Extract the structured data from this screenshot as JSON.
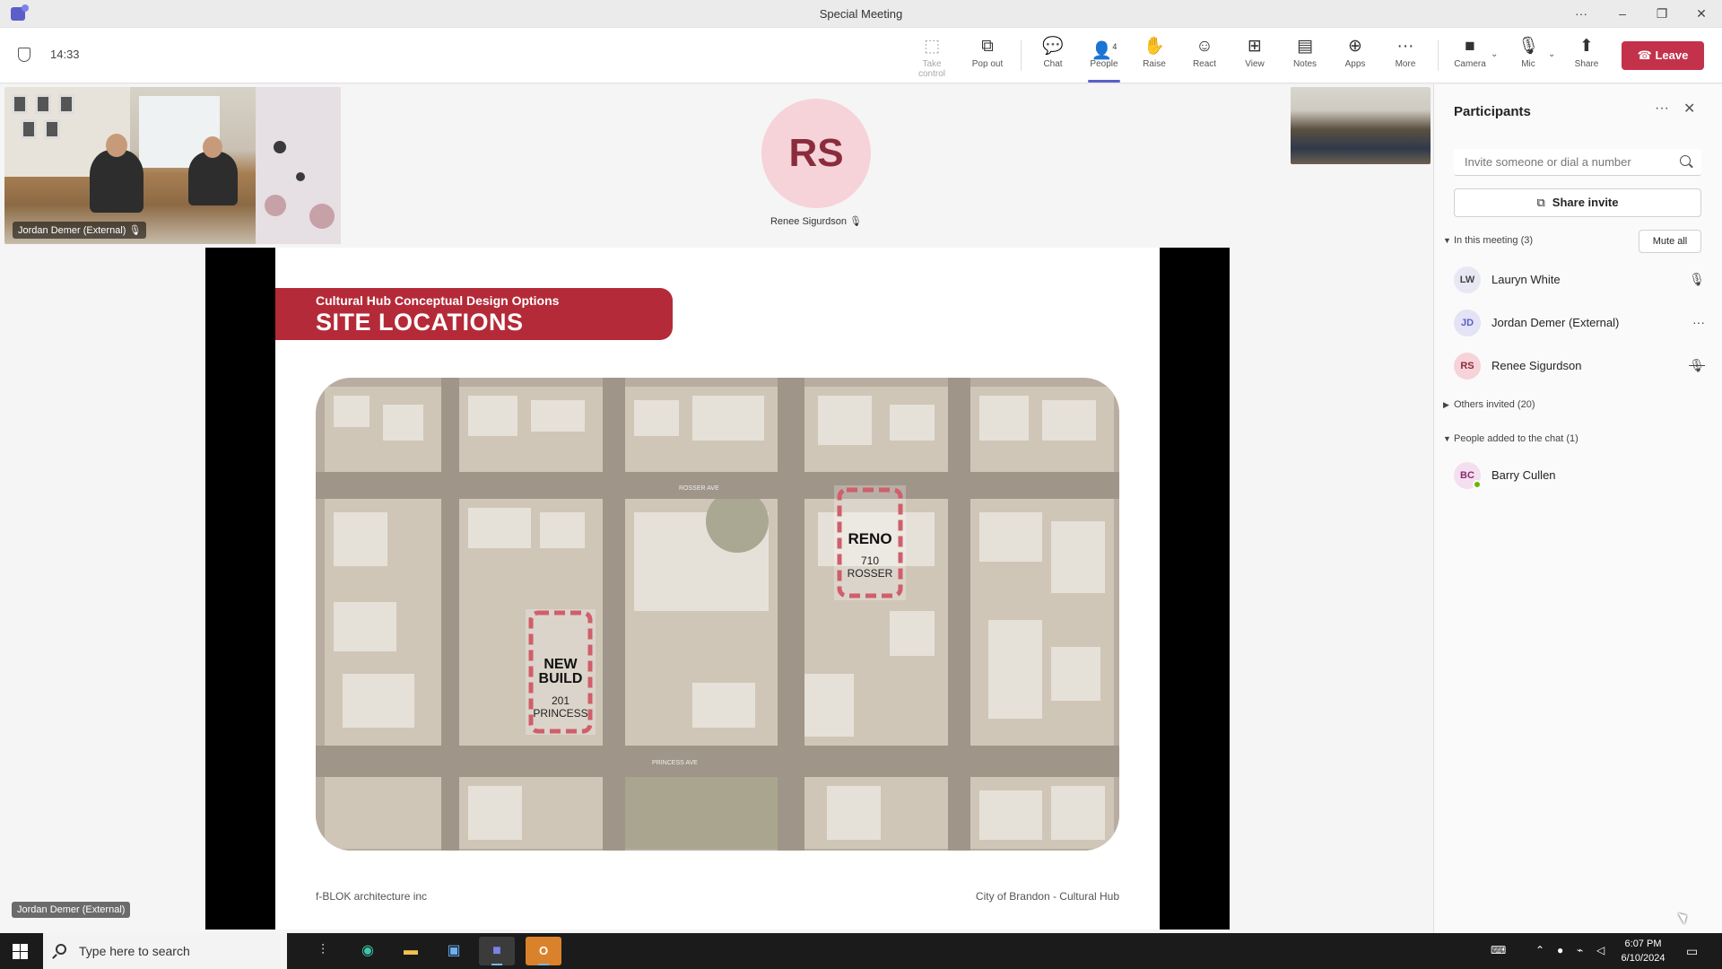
{
  "window": {
    "title": "Special Meeting",
    "controls": {
      "more": "···",
      "minimize": "–",
      "restore": "❐",
      "close": "✕"
    }
  },
  "toolbar": {
    "timer": "14:33",
    "buttons": [
      {
        "label": "Take control",
        "icon": "take-control-icon",
        "glyph": "⬚",
        "disabled": true
      },
      {
        "label": "Pop out",
        "icon": "pop-out-icon",
        "glyph": "⧉"
      },
      {
        "label": "Chat",
        "icon": "chat-icon",
        "glyph": "💬"
      },
      {
        "label": "People",
        "icon": "people-icon",
        "glyph": "👤",
        "badge": "4",
        "active": true
      },
      {
        "label": "Raise",
        "icon": "raise-hand-icon",
        "glyph": "✋"
      },
      {
        "label": "React",
        "icon": "react-icon",
        "glyph": "☺"
      },
      {
        "label": "View",
        "icon": "view-icon",
        "glyph": "⊞"
      },
      {
        "label": "Notes",
        "icon": "notes-icon",
        "glyph": "▤"
      },
      {
        "label": "Apps",
        "icon": "apps-icon",
        "glyph": "⊕"
      },
      {
        "label": "More",
        "icon": "more-icon",
        "glyph": "···"
      },
      {
        "label": "Camera",
        "icon": "camera-icon",
        "glyph": "■"
      },
      {
        "label": "Mic",
        "icon": "mic-icon",
        "glyph": "🎙"
      },
      {
        "label": "Share",
        "icon": "share-icon",
        "glyph": "⬆"
      }
    ],
    "leave_label": "Leave",
    "leave_color": "#c4314b"
  },
  "stage": {
    "video_tile_name": "Jordan Demer (External)",
    "speaker_initials": "RS",
    "speaker_name": "Renee Sigurdson",
    "stage_name_label": "Jordan Demer (External)"
  },
  "slide": {
    "subtitle": "Cultural Hub Conceptual Design Options",
    "title": "SITE LOCATIONS",
    "map_labels": {
      "reno_title": "RENO",
      "reno_address_1": "710",
      "reno_address_2": "ROSSER",
      "new_title_1": "NEW",
      "new_title_2": "BUILD",
      "new_address_1": "201",
      "new_address_2": "PRINCESS",
      "street_top": "ROSSER AVE",
      "street_bottom": "PRINCESS AVE"
    },
    "footer_left": "f-BLOK architecture inc",
    "footer_right": "City of Brandon - Cultural Hub",
    "accent_color": "#b52a38"
  },
  "participants": {
    "title": "Participants",
    "invite_placeholder": "Invite someone or dial a number",
    "share_invite_label": "Share invite",
    "in_meeting_label": "In this meeting (3)",
    "mute_all_label": "Mute all",
    "in_meeting": [
      {
        "initials": "LW",
        "name": "Lauryn White",
        "status": "mic",
        "color": "#e8e8f4",
        "text_color": "#444"
      },
      {
        "initials": "JD",
        "name": "Jordan Demer (External)",
        "status": "more",
        "color": "#e3e3f5",
        "text_color": "#5b5fc7"
      },
      {
        "initials": "RS",
        "name": "Renee Sigurdson",
        "status": "mic-muted",
        "color": "#f6d3d8",
        "text_color": "#8a2c3c"
      }
    ],
    "others_invited_label": "Others invited (20)",
    "added_to_chat_label": "People added to the chat (1)",
    "added": [
      {
        "initials": "BC",
        "name": "Barry Cullen",
        "color": "#f3dff0",
        "text_color": "#8a2c6e"
      }
    ]
  },
  "taskbar": {
    "search_placeholder": "Type here to search",
    "apps": [
      "task-view-icon",
      "edge-icon",
      "file-explorer-icon",
      "store-icon",
      "teams-icon",
      "outlook-icon"
    ],
    "time": "6:07 PM",
    "date": "6/10/2024"
  }
}
